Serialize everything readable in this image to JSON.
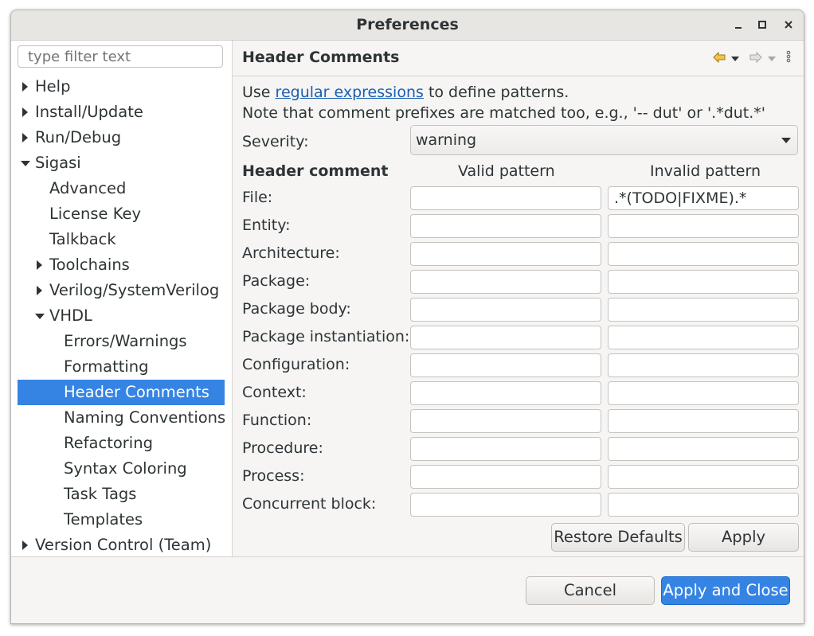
{
  "window": {
    "title": "Preferences"
  },
  "sidebar": {
    "filter_placeholder": "type filter text",
    "items": [
      {
        "label": "Help",
        "level": 0,
        "expander": "collapsed"
      },
      {
        "label": "Install/Update",
        "level": 0,
        "expander": "collapsed"
      },
      {
        "label": "Run/Debug",
        "level": 0,
        "expander": "collapsed"
      },
      {
        "label": "Sigasi",
        "level": 0,
        "expander": "expanded"
      },
      {
        "label": "Advanced",
        "level": 1,
        "expander": "none"
      },
      {
        "label": "License Key",
        "level": 1,
        "expander": "none"
      },
      {
        "label": "Talkback",
        "level": 1,
        "expander": "none"
      },
      {
        "label": "Toolchains",
        "level": 1,
        "expander": "collapsed"
      },
      {
        "label": "Verilog/SystemVerilog",
        "level": 1,
        "expander": "collapsed"
      },
      {
        "label": "VHDL",
        "level": 1,
        "expander": "expanded"
      },
      {
        "label": "Errors/Warnings",
        "level": 2,
        "expander": "none"
      },
      {
        "label": "Formatting",
        "level": 2,
        "expander": "none"
      },
      {
        "label": "Header Comments",
        "level": 2,
        "expander": "none",
        "selected": true
      },
      {
        "label": "Naming Conventions",
        "level": 2,
        "expander": "none"
      },
      {
        "label": "Refactoring",
        "level": 2,
        "expander": "none"
      },
      {
        "label": "Syntax Coloring",
        "level": 2,
        "expander": "none"
      },
      {
        "label": "Task Tags",
        "level": 2,
        "expander": "none"
      },
      {
        "label": "Templates",
        "level": 2,
        "expander": "none"
      },
      {
        "label": "Version Control (Team)",
        "level": 0,
        "expander": "collapsed"
      }
    ]
  },
  "page": {
    "title": "Header Comments",
    "intro_prefix": "Use ",
    "intro_link": "regular expressions",
    "intro_suffix": " to define patterns.",
    "note": "Note that comment prefixes are matched too, e.g., '-- dut' or '.*dut.*'",
    "severity_label": "Severity:",
    "severity_value": "warning",
    "col_header_comment": "Header comment",
    "col_valid": "Valid pattern",
    "col_invalid": "Invalid pattern",
    "rows": [
      {
        "label": "File:",
        "valid": "",
        "invalid": ".*(TODO|FIXME).*"
      },
      {
        "label": "Entity:",
        "valid": "",
        "invalid": ""
      },
      {
        "label": "Architecture:",
        "valid": "",
        "invalid": ""
      },
      {
        "label": "Package:",
        "valid": "",
        "invalid": ""
      },
      {
        "label": "Package body:",
        "valid": "",
        "invalid": ""
      },
      {
        "label": "Package instantiation:",
        "valid": "",
        "invalid": ""
      },
      {
        "label": "Configuration:",
        "valid": "",
        "invalid": ""
      },
      {
        "label": "Context:",
        "valid": "",
        "invalid": ""
      },
      {
        "label": "Function:",
        "valid": "",
        "invalid": ""
      },
      {
        "label": "Procedure:",
        "valid": "",
        "invalid": ""
      },
      {
        "label": "Process:",
        "valid": "",
        "invalid": ""
      },
      {
        "label": "Concurrent block:",
        "valid": "",
        "invalid": ""
      }
    ],
    "restore_defaults": "Restore Defaults",
    "apply": "Apply"
  },
  "footer": {
    "cancel": "Cancel",
    "apply_close": "Apply and Close"
  },
  "icons": {
    "back": "back-arrow-icon",
    "forward": "forward-arrow-icon",
    "menu": "view-menu-icon"
  },
  "colors": {
    "selection": "#3584e4",
    "link": "#1a5fb4"
  }
}
